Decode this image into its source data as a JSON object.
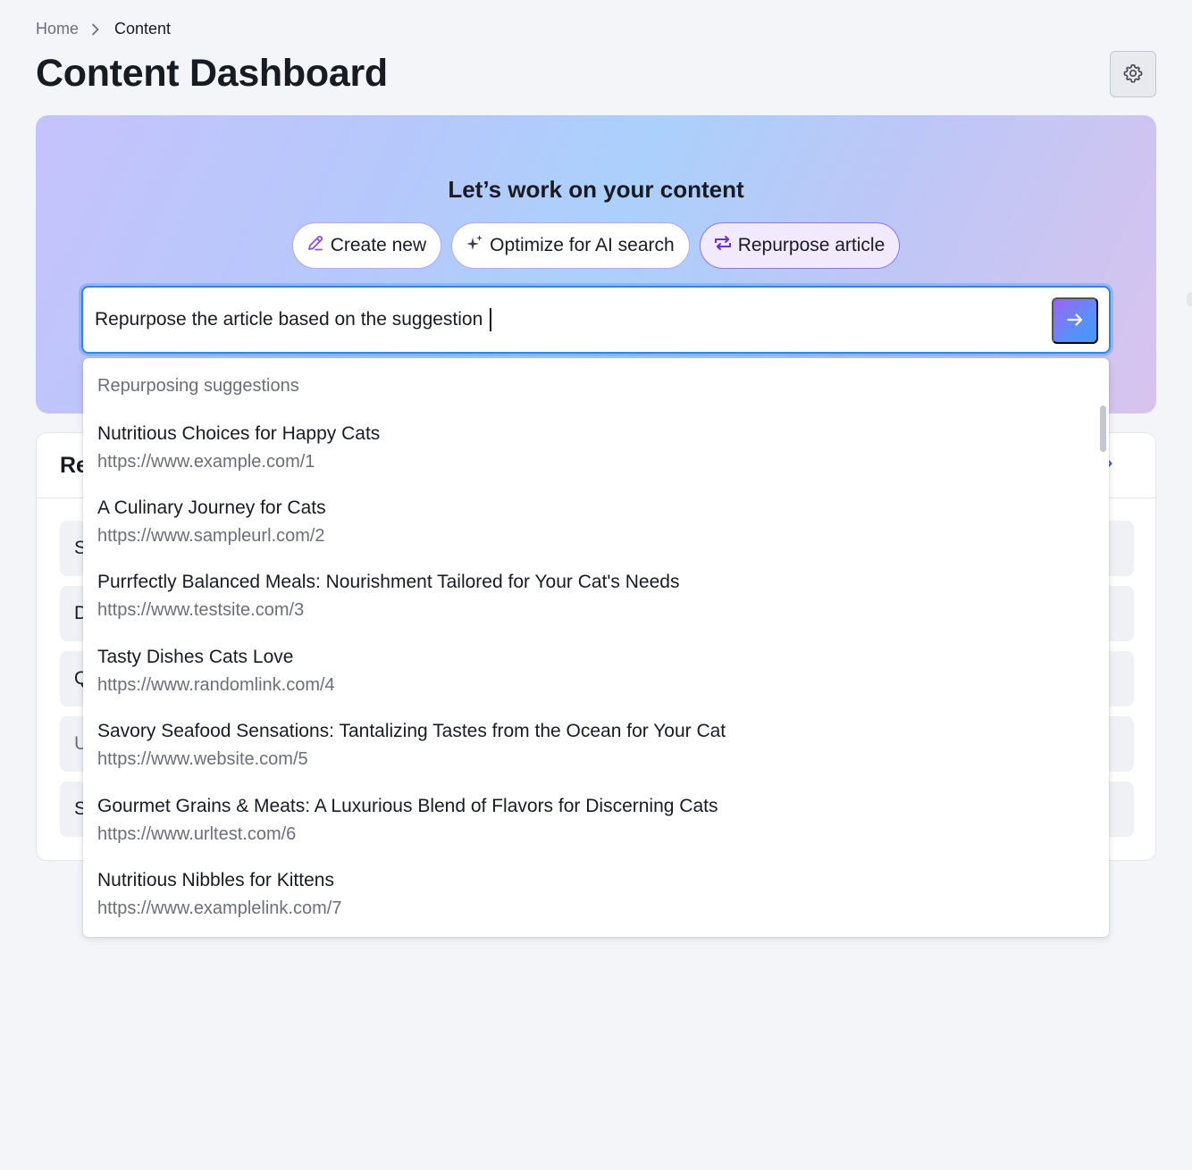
{
  "breadcrumb": {
    "home": "Home",
    "current": "Content"
  },
  "page": {
    "title": "Content Dashboard"
  },
  "hero": {
    "heading": "Let’s work on your content",
    "chips": [
      {
        "label": "Create new",
        "icon": "pencil-icon"
      },
      {
        "label": "Optimize for AI search",
        "icon": "sparkle-icon"
      },
      {
        "label": "Repurpose article",
        "icon": "repurpose-icon"
      }
    ],
    "prompt": {
      "value": "Repurpose the article based on the suggestion"
    }
  },
  "recent": {
    "title": "Re",
    "rows": [
      "S",
      "D",
      "Q",
      "U",
      "S"
    ]
  },
  "dropdown": {
    "heading": "Repurposing suggestions",
    "items": [
      {
        "title": "Nutritious Choices for Happy Cats",
        "url": "https://www.example.com/1"
      },
      {
        "title": "A Culinary Journey for Cats",
        "url": "https://www.sampleurl.com/2"
      },
      {
        "title": "Purrfectly Balanced Meals: Nourishment Tailored for Your Cat's Needs",
        "url": "https://www.testsite.com/3"
      },
      {
        "title": "Tasty Dishes Cats Love",
        "url": "https://www.randomlink.com/4"
      },
      {
        "title": "Savory Seafood Sensations: Tantalizing Tastes from the Ocean for Your Cat",
        "url": "https://www.website.com/5"
      },
      {
        "title": "Gourmet Grains & Meats: A Luxurious Blend of Flavors for Discerning Cats",
        "url": "https://www.urltest.com/6"
      },
      {
        "title": "Nutritious Nibbles for Kittens",
        "url": "https://www.examplelink.com/7"
      }
    ]
  },
  "colors": {
    "accent": "#2d86e6",
    "chip_border": "#b7a6f1",
    "active_chip_border": "#8f76ee",
    "muted_text": "#6c6e79"
  }
}
